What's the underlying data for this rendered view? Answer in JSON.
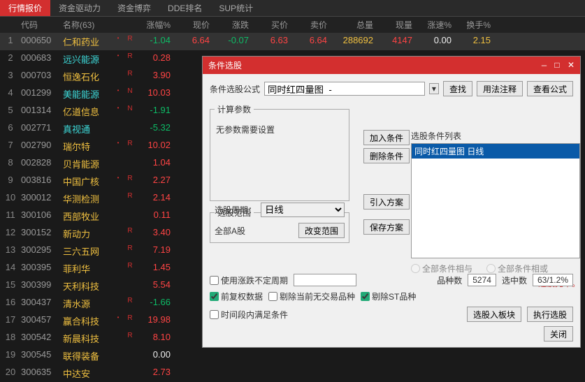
{
  "tabs": [
    "行情报价",
    "资金驱动力",
    "资金博弈",
    "DDE排名",
    "SUP统计"
  ],
  "headers": {
    "code": "代码",
    "name": "名称(63)",
    "pct": "涨幅%",
    "price": "现价",
    "chg": "涨跌",
    "buy": "买价",
    "sell": "卖价",
    "vol": "总量",
    "cur": "现量",
    "spd": "涨速%",
    "turn": "换手%"
  },
  "rows": [
    {
      "i": "1",
      "code": "000650",
      "name": "仁和药业",
      "flag": "R",
      "dot": "•",
      "pct": "-1.04",
      "pctCls": "green",
      "price": "6.64",
      "priceCls": "red",
      "chg": "-0.07",
      "chgCls": "green",
      "buy": "6.63",
      "buyCls": "red",
      "sell": "6.64",
      "sellCls": "red",
      "vol": "288692",
      "cur": "4147",
      "curCls": "red",
      "spd": "0.00",
      "turn": "2.15",
      "hl": true
    },
    {
      "i": "2",
      "code": "000683",
      "name": "远兴能源",
      "nameCls": "cyan",
      "flag": "R",
      "dot": "•",
      "pct": "0.28",
      "pctCls": "red",
      "price": "",
      "chg": "",
      "buy": "",
      "sell": "",
      "vol": "",
      "cur": "",
      "spd": "",
      "turn": ""
    },
    {
      "i": "3",
      "code": "000703",
      "name": "恒逸石化",
      "flag": "R",
      "dot": "",
      "pct": "3.90",
      "pctCls": "red"
    },
    {
      "i": "4",
      "code": "001299",
      "name": "美能能源",
      "nameCls": "cyan",
      "flag": "N",
      "dot": "•",
      "pct": "10.03",
      "pctCls": "red"
    },
    {
      "i": "5",
      "code": "001314",
      "name": "亿道信息",
      "flag": "N",
      "dot": "•",
      "pct": "-1.91",
      "pctCls": "green"
    },
    {
      "i": "6",
      "code": "002771",
      "name": "真视通",
      "nameCls": "cyan",
      "flag": "",
      "dot": "",
      "pct": "-5.32",
      "pctCls": "green"
    },
    {
      "i": "7",
      "code": "002790",
      "name": "瑞尔特",
      "flag": "R",
      "dot": "•",
      "pct": "10.02",
      "pctCls": "red"
    },
    {
      "i": "8",
      "code": "002828",
      "name": "贝肯能源",
      "flag": "",
      "dot": "",
      "pct": "1.04",
      "pctCls": "red"
    },
    {
      "i": "9",
      "code": "003816",
      "name": "中国广核",
      "flag": "R",
      "dot": "•",
      "pct": "2.27",
      "pctCls": "red"
    },
    {
      "i": "10",
      "code": "300012",
      "name": "华测检测",
      "flag": "R",
      "dot": "",
      "pct": "2.14",
      "pctCls": "red"
    },
    {
      "i": "11",
      "code": "300106",
      "name": "西部牧业",
      "flag": "",
      "dot": "",
      "pct": "0.11",
      "pctCls": "red"
    },
    {
      "i": "12",
      "code": "300152",
      "name": "新动力",
      "flag": "R",
      "dot": "",
      "pct": "3.40",
      "pctCls": "red"
    },
    {
      "i": "13",
      "code": "300295",
      "name": "三六五网",
      "flag": "R",
      "dot": "",
      "pct": "7.19",
      "pctCls": "red"
    },
    {
      "i": "14",
      "code": "300395",
      "name": "菲利华",
      "flag": "R",
      "dot": "",
      "pct": "1.45",
      "pctCls": "red"
    },
    {
      "i": "15",
      "code": "300399",
      "name": "天利科技",
      "flag": "",
      "dot": "",
      "pct": "5.54",
      "pctCls": "red"
    },
    {
      "i": "16",
      "code": "300437",
      "name": "清水源",
      "flag": "R",
      "dot": "",
      "pct": "-1.66",
      "pctCls": "green"
    },
    {
      "i": "17",
      "code": "300457",
      "name": "赢合科技",
      "flag": "R",
      "dot": "•",
      "pct": "19.98",
      "pctCls": "red"
    },
    {
      "i": "18",
      "code": "300542",
      "name": "新晨科技",
      "flag": "R",
      "dot": "",
      "pct": "8.10",
      "pctCls": "red"
    },
    {
      "i": "19",
      "code": "300545",
      "name": "联得装备",
      "flag": "",
      "dot": "",
      "pct": "0.00",
      "pctCls": "white"
    },
    {
      "i": "20",
      "code": "300635",
      "name": "中达安",
      "flag": "",
      "dot": "",
      "pct": "2.73",
      "pctCls": "red"
    }
  ],
  "dialog": {
    "title": "条件选股",
    "formula_label": "条件选股公式",
    "formula_value": "同时红四量图  -",
    "find": "查找",
    "usage": "用法注释",
    "view": "查看公式",
    "params_legend": "计算参数",
    "no_params": "无参数需要设置",
    "period_label": "选股周期：",
    "period_value": "日线",
    "scope_legend": "选股范围",
    "scope_value": "全部A股",
    "change_scope": "改变范围",
    "add_cond": "加入条件",
    "del_cond": "删除条件",
    "import_plan": "引入方案",
    "save_plan": "保存方案",
    "cond_list_label": "选股条件列表",
    "cond_item": "同时红四量图  日线",
    "radio_and": "全部条件相与",
    "radio_or": "全部条件相或",
    "done": "选股完毕。",
    "use_range": "使用涨跌不定周期",
    "count_label": "品种数",
    "count_val": "5274",
    "sel_label": "选中数",
    "sel_val": "63/1.2%",
    "pre_adj": "前复权数据",
    "excl_nontrade": "剔除当前无交易品种",
    "excl_st": "剔除ST品种",
    "time_cond": "时间段内满足条件",
    "into_block": "选股入板块",
    "exec": "执行选股",
    "close": "关闭"
  }
}
